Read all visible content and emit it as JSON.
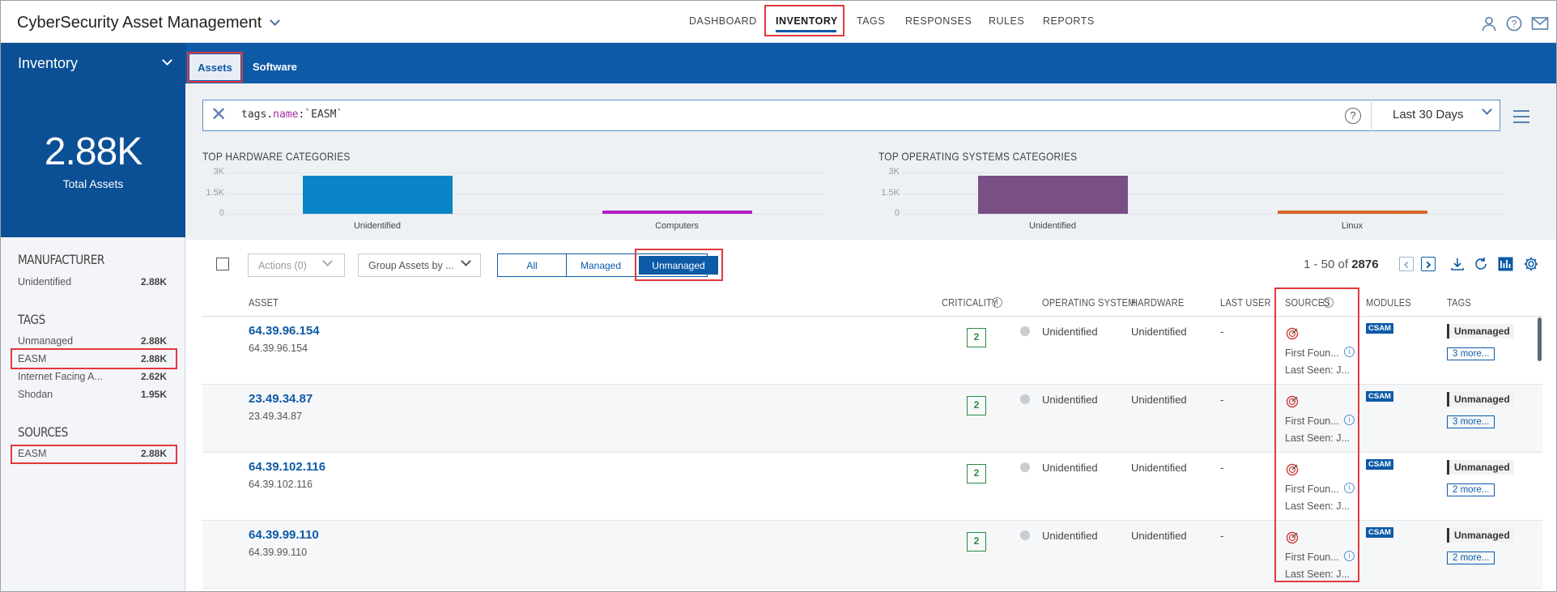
{
  "app": {
    "title": "CyberSecurity Asset Management"
  },
  "nav": {
    "items": [
      "DASHBOARD",
      "INVENTORY",
      "TAGS",
      "RESPONSES",
      "RULES",
      "REPORTS"
    ],
    "active": "INVENTORY"
  },
  "subnav": {
    "section": "Inventory",
    "tabs": [
      "Assets",
      "Software"
    ]
  },
  "summary": {
    "total": "2.88K",
    "label": "Total Assets"
  },
  "filters": {
    "manufacturer": {
      "title": "MANUFACTURER",
      "items": [
        {
          "label": "Unidentified",
          "value": "2.88K"
        }
      ]
    },
    "tags": {
      "title": "TAGS",
      "items": [
        {
          "label": "Unmanaged",
          "value": "2.88K"
        },
        {
          "label": "EASM",
          "value": "2.88K"
        },
        {
          "label": "Internet Facing A...",
          "value": "2.62K"
        },
        {
          "label": "Shodan",
          "value": "1.95K"
        }
      ]
    },
    "sources": {
      "title": "SOURCES",
      "items": [
        {
          "label": "EASM",
          "value": "2.88K"
        }
      ]
    }
  },
  "search": {
    "prefix": "tags.",
    "keyword": "name",
    "rest": ":`EASM`",
    "range": "Last 30 Days",
    "help": "?"
  },
  "chart_data": [
    {
      "type": "bar",
      "title": "TOP HARDWARE CATEGORIES",
      "categories": [
        "Unidentified",
        "Computers"
      ],
      "values": [
        2750,
        130
      ],
      "yticks": [
        "3K",
        "1.5K",
        "0"
      ],
      "ylim": [
        0,
        3000
      ],
      "colors": [
        "#0a84c6",
        "#b01fc6"
      ]
    },
    {
      "type": "bar",
      "title": "TOP OPERATING SYSTEMS CATEGORIES",
      "categories": [
        "Unidentified",
        "Linux"
      ],
      "values": [
        2750,
        130
      ],
      "yticks": [
        "3K",
        "1.5K",
        "0"
      ],
      "ylim": [
        0,
        3000
      ],
      "colors": [
        "#7a4f86",
        "#d4682a"
      ]
    }
  ],
  "toolbar": {
    "actions": "Actions (0)",
    "group": "Group Assets by ...",
    "segments": [
      "All",
      "Managed",
      "Unmanaged"
    ],
    "active_segment": "Unmanaged",
    "range": "1 - 50 of",
    "total": "2876"
  },
  "columns": [
    "ASSET",
    "CRITICALITY",
    "OPERATING SYSTEM",
    "HARDWARE",
    "LAST USER",
    "SOURCES",
    "MODULES",
    "TAGS"
  ],
  "rows": [
    {
      "name": "64.39.96.154",
      "ip": "64.39.96.154",
      "criticality": "2",
      "os": "Unidentified",
      "hardware": "Unidentified",
      "user": "-",
      "first": "First Foun...",
      "last": "Last Seen: J...",
      "module": "CSAM",
      "tag": "Unmanaged",
      "more": "3 more..."
    },
    {
      "name": "23.49.34.87",
      "ip": "23.49.34.87",
      "criticality": "2",
      "os": "Unidentified",
      "hardware": "Unidentified",
      "user": "-",
      "first": "First Foun...",
      "last": "Last Seen: J...",
      "module": "CSAM",
      "tag": "Unmanaged",
      "more": "3 more..."
    },
    {
      "name": "64.39.102.116",
      "ip": "64.39.102.116",
      "criticality": "2",
      "os": "Unidentified",
      "hardware": "Unidentified",
      "user": "-",
      "first": "First Foun...",
      "last": "Last Seen: J...",
      "module": "CSAM",
      "tag": "Unmanaged",
      "more": "2 more..."
    },
    {
      "name": "64.39.99.110",
      "ip": "64.39.99.110",
      "criticality": "2",
      "os": "Unidentified",
      "hardware": "Unidentified",
      "user": "-",
      "first": "First Foun...",
      "last": "Last Seen: J...",
      "module": "CSAM",
      "tag": "Unmanaged",
      "more": "2 more..."
    }
  ],
  "colors": {
    "brand": "#0d5aa7",
    "brand_dark": "#0b4f95",
    "highlight": "#e0393e",
    "critical_low": "#2e8b3e"
  }
}
